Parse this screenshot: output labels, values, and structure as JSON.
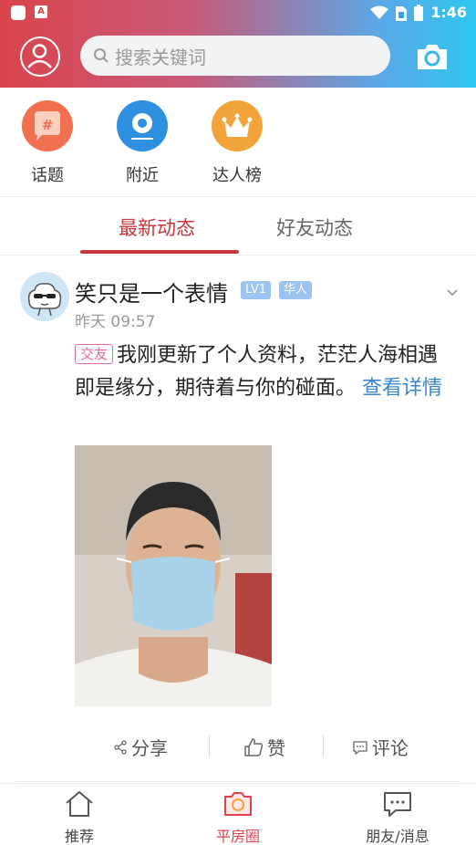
{
  "statusbar": {
    "time": "1:46",
    "app_badge": "A"
  },
  "search": {
    "placeholder": "搜索关键词"
  },
  "quick_links": [
    {
      "label": "话题",
      "icon": "hashtag-icon",
      "color": "#f07050"
    },
    {
      "label": "附近",
      "icon": "location-icon",
      "color": "#2f8fe0"
    },
    {
      "label": "达人榜",
      "icon": "crown-icon",
      "color": "#f2a33a"
    }
  ],
  "tabs": [
    {
      "label": "最新动态",
      "active": true
    },
    {
      "label": "好友动态",
      "active": false
    }
  ],
  "post": {
    "username": "笑只是一个表情",
    "level_badge": "LV1",
    "group_badge": "华人",
    "time": "昨天 09:57",
    "tag": "交友",
    "text": "我刚更新了个人资料，茫茫人海相遇即是缘分，期待着与你的碰面。",
    "more_link": "查看详情",
    "actions": {
      "share": "分享",
      "like": "赞",
      "comment": "评论"
    }
  },
  "bottom_nav": [
    {
      "label": "推荐",
      "icon": "home-icon",
      "active": false
    },
    {
      "label": "平房圈",
      "icon": "camera-icon",
      "active": true
    },
    {
      "label": "朋友/消息",
      "icon": "chat-icon",
      "active": false
    }
  ],
  "colors": {
    "accent": "#c8373c",
    "link": "#3a86c8"
  }
}
